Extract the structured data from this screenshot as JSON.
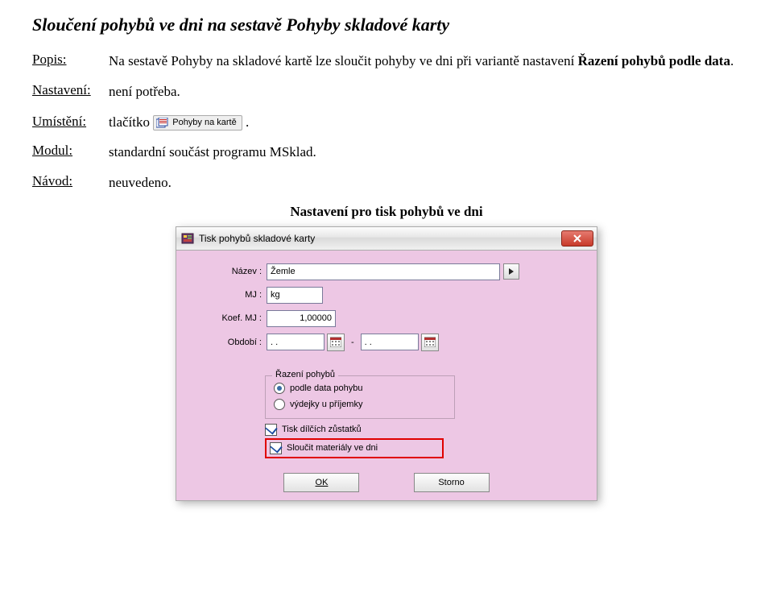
{
  "heading": "Sloučení pohybů ve dni na sestavě Pohyby skladové karty",
  "defs": {
    "popis_label": "Popis:",
    "popis_pre": "Na sestavě Pohyby na skladové kartě lze sloučit pohyby ve dni při variantě nastavení ",
    "popis_bold": "Řazení pohybů podle data",
    "popis_post": ".",
    "nastaveni_label": "Nastavení:",
    "nastaveni_value": "není potřeba.",
    "umisteni_label": "Umístění:",
    "umisteni_pre": "tlačítko ",
    "umisteni_btn": "Pohyby na kartě",
    "umisteni_post": ".",
    "modul_label": "Modul:",
    "modul_value": "standardní součást programu MSklad.",
    "navod_label": "Návod:",
    "navod_value": "neuvedeno."
  },
  "caption": "Nastavení pro tisk pohybů ve dni",
  "dialog": {
    "title": "Tisk pohybů skladové karty",
    "fields": {
      "nazev_label": "Název :",
      "nazev_value": "Žemle",
      "mj_label": "MJ :",
      "mj_value": "kg",
      "koef_label": "Koef. MJ :",
      "koef_value": "1,00000",
      "obdobi_label": "Období :",
      "obdobi_from": ".  .",
      "obdobi_to": ".  ."
    },
    "group": {
      "title": "Řazení pohybů",
      "r1": "podle data pohybu",
      "r2": "výdejky u příjemky"
    },
    "checks": {
      "c1": "Tisk dílčích zůstatků",
      "c2": "Sloučit materiály ve dni"
    },
    "buttons": {
      "ok": "OK",
      "storno": "Storno"
    }
  }
}
